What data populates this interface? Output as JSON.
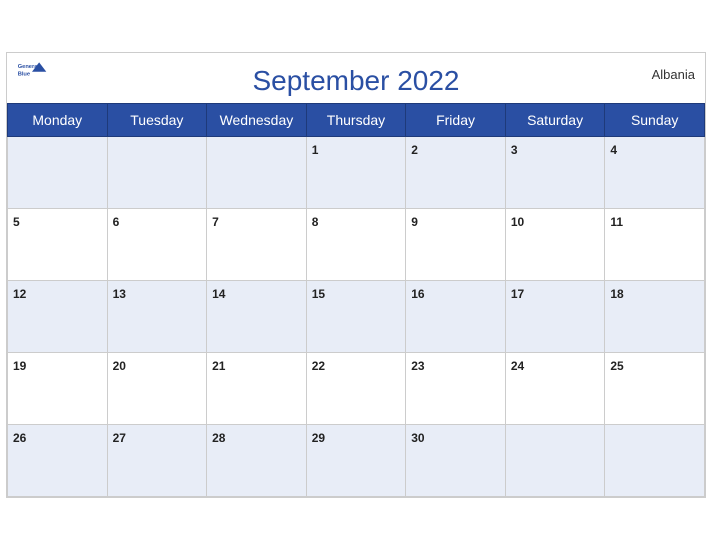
{
  "header": {
    "title": "September 2022",
    "country": "Albania",
    "logo": {
      "line1": "General",
      "line2": "Blue"
    }
  },
  "weekdays": [
    "Monday",
    "Tuesday",
    "Wednesday",
    "Thursday",
    "Friday",
    "Saturday",
    "Sunday"
  ],
  "weeks": [
    [
      null,
      null,
      null,
      1,
      2,
      3,
      4
    ],
    [
      5,
      6,
      7,
      8,
      9,
      10,
      11
    ],
    [
      12,
      13,
      14,
      15,
      16,
      17,
      18
    ],
    [
      19,
      20,
      21,
      22,
      23,
      24,
      25
    ],
    [
      26,
      27,
      28,
      29,
      30,
      null,
      null
    ]
  ]
}
